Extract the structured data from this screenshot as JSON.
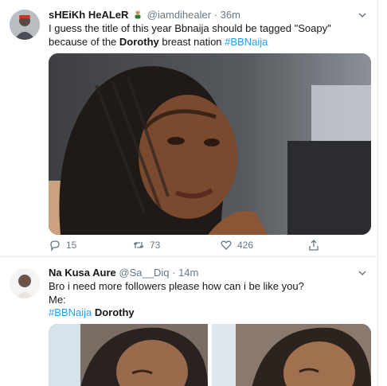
{
  "tweets": [
    {
      "display_name": "sHEiKh HeALeR",
      "handle": "@iamdihealer",
      "dot": "·",
      "time": "36m",
      "text_part1": "I guess the title of this year Bbnaija should be tagged \"Soapy\" because of the ",
      "text_bold": "Dorothy",
      "text_part2": " breast nation ",
      "hashtag": "#BBNaija",
      "replies": "15",
      "retweets": "73",
      "likes": "426"
    },
    {
      "display_name": "Na Kusa Aure",
      "handle": "@Sa__Diq",
      "dot": "·",
      "time": "14m",
      "line1": "Bro i need more followers please how can i be like you?",
      "line2": "Me:",
      "hashtag": "#BBNaija",
      "bold": "Dorothy"
    }
  ],
  "colors": {
    "link": "#1da1f2",
    "muted": "#657786",
    "border": "#e6ecf0"
  },
  "icons": [
    "reply-icon",
    "retweet-icon",
    "like-icon",
    "share-icon",
    "chevron-down-icon"
  ]
}
